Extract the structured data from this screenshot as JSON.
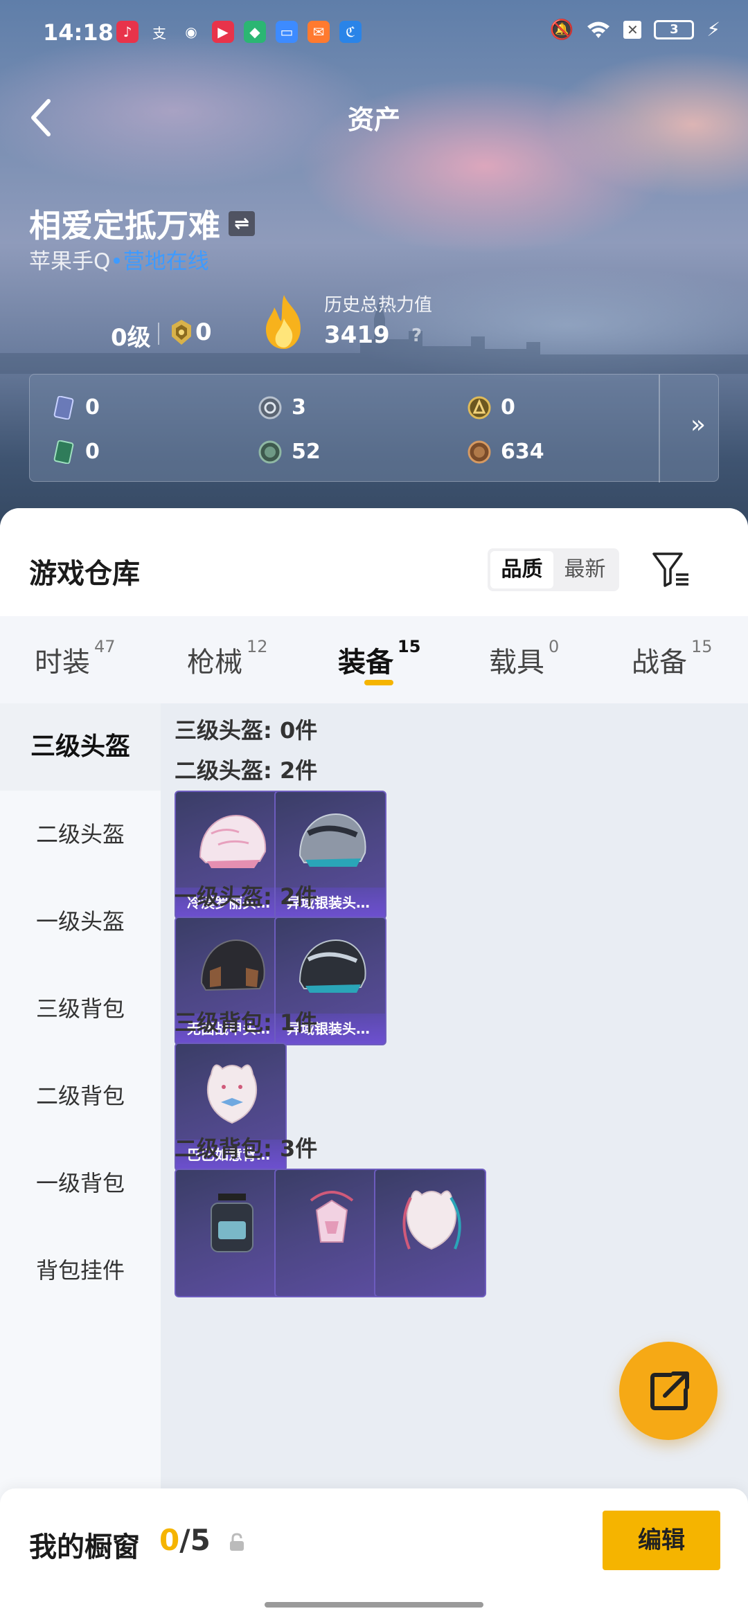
{
  "status_bar": {
    "time": "14:18",
    "battery": "3",
    "notification_icons": [
      "music-icon",
      "alipay-icon",
      "wechat-icon",
      "video-icon",
      "security-icon",
      "files-icon",
      "mail-icon",
      "telecom-icon"
    ]
  },
  "header": {
    "title": "资产"
  },
  "profile": {
    "username": "相爱定抵万难",
    "platform": "苹果手Q",
    "online_status": "营地在线",
    "level": "0级",
    "rank_value": "0",
    "heat_label": "历史总热力值",
    "heat_value": "3419",
    "help": "?"
  },
  "currencies": [
    {
      "icon": "card-currency-icon",
      "value": "0",
      "color": "#6a7ab8"
    },
    {
      "icon": "silver-coin-icon",
      "value": "3",
      "color": "#8a97a8"
    },
    {
      "icon": "gold-coin-icon",
      "value": "0",
      "color": "#c8a344"
    },
    {
      "icon": "green-card-icon",
      "value": "0",
      "color": "#3f9a72"
    },
    {
      "icon": "green-coin-icon",
      "value": "52",
      "color": "#5d8a78"
    },
    {
      "icon": "bronze-coin-icon",
      "value": "634",
      "color": "#b07a4a"
    }
  ],
  "warehouse": {
    "title": "游戏仓库",
    "sort_options": [
      "品质",
      "最新"
    ],
    "active_sort": "品质"
  },
  "tabs": [
    {
      "label": "时装",
      "count": "47"
    },
    {
      "label": "枪械",
      "count": "12"
    },
    {
      "label": "装备",
      "count": "15"
    },
    {
      "label": "载具",
      "count": "0"
    },
    {
      "label": "战备",
      "count": "15"
    }
  ],
  "active_tab": "装备",
  "categories": [
    "三级头盔",
    "二级头盔",
    "一级头盔",
    "三级背包",
    "二级背包",
    "一级背包",
    "背包挂件"
  ],
  "sections": {
    "s0": "三级头盔: 0件",
    "s1": "二级头盔: 2件",
    "s2": "一级头盔: 2件",
    "s3": "三级背包: 1件",
    "s4": "二级背包: 3件"
  },
  "items": {
    "i0": "冷漠罗丽头…",
    "i1": "异域银装头…",
    "i2": "无面战甲头…",
    "i3": "异域银装头…",
    "i4": "巴巴如意背…"
  },
  "showcase": {
    "label": "我的橱窗",
    "current": "0",
    "total": "/5",
    "edit": "编辑"
  },
  "colors": {
    "accent": "#f5b400",
    "online": "#3e9bff",
    "fab": "#f6a915",
    "card": "#4b4682"
  }
}
